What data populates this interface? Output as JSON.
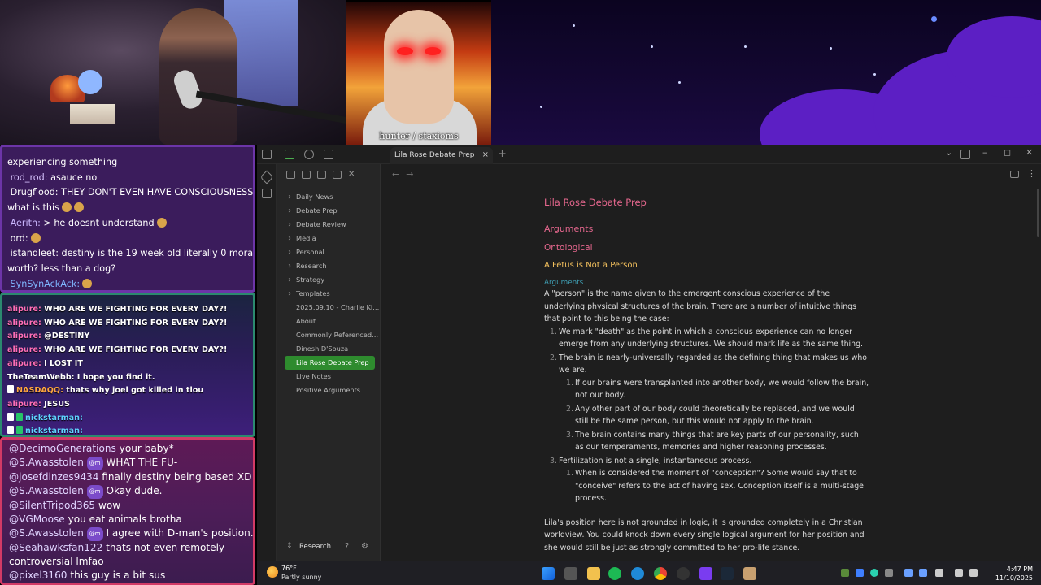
{
  "overlay": {
    "guest_caption": "hunter / staxioms"
  },
  "chat_top": {
    "lines": [
      {
        "user": "",
        "text": "experiencing something"
      },
      {
        "user": "rod_rod:",
        "text": " asauce no"
      },
      {
        "user": "Drugflood:",
        "text": " THEY DON'T EVEN HAVE CONSCIOUSNESS"
      },
      {
        "user": "",
        "text": "what is this"
      },
      {
        "user": "Aerith:",
        "text": " > he doesnt understand"
      },
      {
        "user": "ord:",
        "text": ""
      },
      {
        "user": "istandleet:",
        "text": " destiny is the 19 week old literally 0 moral"
      },
      {
        "user": "",
        "text": "worth? less than a dog?"
      },
      {
        "user": "SynSynAckAck:",
        "text": ""
      }
    ]
  },
  "chat_mid": {
    "lines": [
      {
        "user": "alipure:",
        "text": " WHO ARE WE FIGHTING FOR EVERY DAY?!",
        "color": "pink"
      },
      {
        "user": "alipure:",
        "text": " WHO ARE WE FIGHTING FOR EVERY DAY?!",
        "color": "pink"
      },
      {
        "user": "alipure:",
        "text": " @DESTINY",
        "color": "pink"
      },
      {
        "user": "alipure:",
        "text": " WHO ARE WE FIGHTING FOR EVERY DAY?!",
        "color": "pink"
      },
      {
        "user": "alipure:",
        "text": " I LOST IT",
        "color": "pink"
      },
      {
        "user": "TheTeamWebb:",
        "text": " I hope you find it.",
        "color": "white"
      },
      {
        "user": "NASDAQQ:",
        "text": " thats why joel got killed in tlou",
        "color": "orange"
      },
      {
        "user": "alipure:",
        "text": " JESUS",
        "color": "pink"
      },
      {
        "user": "nickstarman:",
        "text": "",
        "color": "cyan"
      },
      {
        "user": "nickstarman:",
        "text": "",
        "color": "cyan"
      }
    ]
  },
  "chat_bottom": {
    "lines": [
      {
        "user": "@DecimoGenerations",
        "text": " your baby*"
      },
      {
        "user": "@S.Awasstolen",
        "text": " WHAT THE FU-"
      },
      {
        "user": "@josefdinzes9434",
        "text": " finally destiny being based XD"
      },
      {
        "user": "@S.Awasstolen",
        "text": " Okay dude."
      },
      {
        "user": "@SilentTripod365",
        "text": " wow"
      },
      {
        "user": "@VGMoose",
        "text": " you eat animals brotha"
      },
      {
        "user": "@S.Awasstolen",
        "text": " I agree with D-man's position."
      },
      {
        "user": "@Seahawksfan122",
        "text": " thats not even remotely"
      },
      {
        "user": "",
        "text": "controversial lmfao"
      },
      {
        "user": "@pixel3160",
        "text": " this guy is a bit sus"
      }
    ],
    "mod_badge": "@m"
  },
  "obsidian": {
    "tab_title": "Lila Rose Debate Prep",
    "tab_close": "×",
    "new_tab": "+",
    "sidebar_items": [
      {
        "label": "Daily News",
        "folder": true
      },
      {
        "label": "Debate Prep",
        "folder": true
      },
      {
        "label": "Debate Review",
        "folder": true
      },
      {
        "label": "Media",
        "folder": true
      },
      {
        "label": "Personal",
        "folder": true
      },
      {
        "label": "Research",
        "folder": true
      },
      {
        "label": "Strategy",
        "folder": true
      },
      {
        "label": "Templates",
        "folder": true
      },
      {
        "label": "2025.09.10 - Charlie Kir...",
        "folder": false
      },
      {
        "label": "About",
        "folder": false
      },
      {
        "label": "Commonly Referenced ...",
        "folder": false
      },
      {
        "label": "Dinesh D'Souza",
        "folder": false
      },
      {
        "label": "Lila Rose Debate Prep",
        "folder": false,
        "active": true
      },
      {
        "label": "Live Notes",
        "folder": false
      },
      {
        "label": "Positive Arguments",
        "folder": false
      }
    ],
    "vault_name": "Research",
    "doc": {
      "title": "Lila Rose Debate Prep",
      "h1": "Arguments",
      "h2": "Ontological",
      "h3": "A Fetus is Not a Person",
      "h4": "Arguments",
      "intro": "A \"person\" is the name given to the emergent conscious experience of the underlying physical structures of the brain. There are a number of intuitive things that point to this being the case:",
      "list": [
        {
          "n": "1.",
          "text": "We mark \"death\" as the point in which a conscious experience can no longer emerge from any underlying structures. We should mark life as the same thing."
        },
        {
          "n": "2.",
          "text": "The brain is nearly-universally regarded as the defining thing that makes us who we are."
        },
        {
          "n": "1.",
          "text": "If our brains were transplanted into another body, we would follow the brain, not our body."
        },
        {
          "n": "2.",
          "text": "Any other part of our body could theoretically be replaced, and we would still be the same person, but this would not apply to the brain."
        },
        {
          "n": "3.",
          "text": "The brain contains many things that are key parts of our personality, such as our temperaments, memories and higher reasoning processes."
        },
        {
          "n": "3.",
          "text": "Fertilization is not a single, instantaneous process."
        },
        {
          "n": "1.",
          "text": "When is considered the moment of \"conception\"? Some would say that to \"conceive\" refers to the act of having sex. Conception itself is a multi-stage process."
        }
      ],
      "closing": "Lila's position here is not grounded in logic, it is grounded completely in a Christian worldview. You could knock down every single logical argument for her position and she would still be just as strongly committed to her pro-life stance."
    }
  },
  "taskbar": {
    "temp": "76°F",
    "weather": "Partly sunny",
    "time": "4:47 PM",
    "date": "11/10/2025"
  },
  "colors": {
    "accent_pink": "#e8688f",
    "heading_yellow": "#f5c25e",
    "active_green": "#2e8b2e"
  }
}
